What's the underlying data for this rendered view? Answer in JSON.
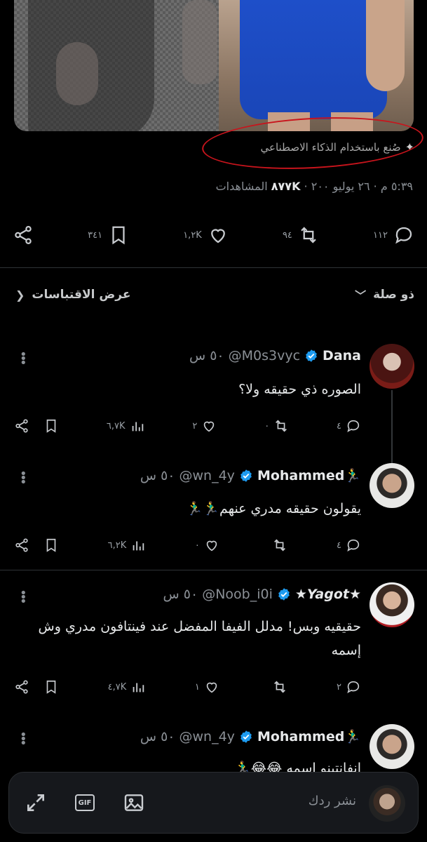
{
  "post": {
    "ai_label": "صُنع باستخدام الذكاء الاصطناعي",
    "time": "٥:٣٩ م",
    "date": "٢٦ يوليو ٢٠٠",
    "views_count": "٨٧٧K",
    "views_label": "المشاهدات",
    "stats": {
      "replies": "١١٢",
      "reposts": "٩٤",
      "likes": "١,٢K",
      "bookmarks": "٣٤١"
    }
  },
  "sort": {
    "label": "ذو صلة",
    "quotes_link": "عرض الاقتباسات"
  },
  "replies": [
    {
      "name": "Dana",
      "handle": "@M0s3vyc",
      "time": "٥٠ س",
      "text": "الصوره ذي حقيقه ولا؟",
      "replies": "٤",
      "reposts": "٠",
      "likes": "٢",
      "views": "٦,٧K"
    },
    {
      "name": "Mohammed🏃‍♂️",
      "handle": "@wn_4y",
      "time": "٥٠ س",
      "text": "يقولون حقيقه مدري عنهم🏃‍♂️🏃‍♂️",
      "replies": "٤",
      "reposts": "",
      "likes": "٠",
      "views": "٦,٢K"
    },
    {
      "name": "★Yagot★",
      "handle": "@Noob_i0i",
      "time": "٥٠ س",
      "text": "حقيقيه وبس! مدلل الفيفا المفضل عند فينتافون مدري وش إسمه",
      "replies": "٢",
      "reposts": "",
      "likes": "١",
      "views": "٤,٧K"
    },
    {
      "name": "Mohammed🏃‍♂️",
      "handle": "@wn_4y",
      "time": "٥٠ س",
      "text": "انفانتينو اسمه 😂😂🏃‍♂️"
    }
  ],
  "composer": {
    "placeholder": "نشر ردك"
  },
  "colors": {
    "background": "#000000",
    "verified": "#1d9bf0",
    "annotation": "#c8141c"
  }
}
